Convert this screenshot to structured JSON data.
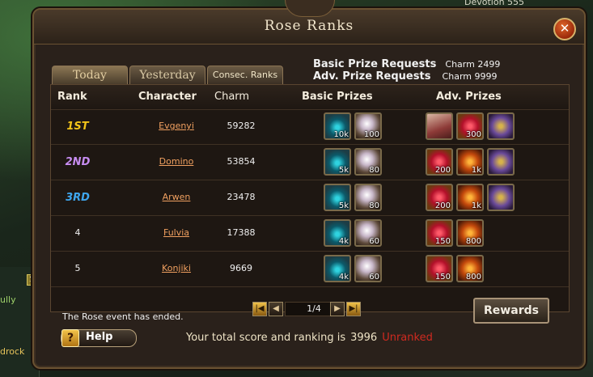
{
  "background": {
    "top_right_text": "Devotion 555",
    "left_text_1": "ully",
    "left_text_2": "drock"
  },
  "window": {
    "title": "Rose Ranks",
    "close_label": "✕"
  },
  "tabs": [
    {
      "label": "Today"
    },
    {
      "label": "Yesterday"
    },
    {
      "label": "Consec. Ranks"
    }
  ],
  "prize_requests": {
    "basic_label": "Basic Prize Requests",
    "basic_value": "Charm 2499",
    "adv_label": "Adv. Prize Requests",
    "adv_value": "Charm 9999"
  },
  "table": {
    "headers": {
      "rank": "Rank",
      "character": "Character",
      "charm": "Charm",
      "basic": "Basic Prizes",
      "adv": "Adv. Prizes"
    },
    "rows": [
      {
        "rank": "1ST",
        "rank_color": "#f2c419",
        "character": "Evgenyi",
        "charm": "59282",
        "basic": [
          {
            "icon": "shield-icon",
            "count": "10k"
          },
          {
            "icon": "pearl-icon",
            "count": "100"
          }
        ],
        "adv": [
          {
            "icon": "fairy-icon",
            "count": ""
          },
          {
            "icon": "gem-icon",
            "count": "300"
          },
          {
            "icon": "horn-icon",
            "count": ""
          }
        ]
      },
      {
        "rank": "2ND",
        "rank_color": "#c68cf0",
        "character": "Domino",
        "charm": "53854",
        "basic": [
          {
            "icon": "shield-icon",
            "count": "5k"
          },
          {
            "icon": "pearl-icon",
            "count": "80"
          }
        ],
        "adv": [
          {
            "icon": "gem-icon",
            "count": "200"
          },
          {
            "icon": "orb-icon",
            "count": "1k"
          },
          {
            "icon": "horn-icon",
            "count": ""
          }
        ]
      },
      {
        "rank": "3RD",
        "rank_color": "#3fa6ee",
        "character": "Arwen",
        "charm": "23478",
        "basic": [
          {
            "icon": "shield-icon",
            "count": "5k"
          },
          {
            "icon": "pearl-icon",
            "count": "80"
          }
        ],
        "adv": [
          {
            "icon": "gem-icon",
            "count": "200"
          },
          {
            "icon": "orb-icon",
            "count": "1k"
          },
          {
            "icon": "horn-icon",
            "count": ""
          }
        ]
      },
      {
        "rank": "4",
        "rank_color": "#f0f0f0",
        "character": "Fulvia",
        "charm": "17388",
        "basic": [
          {
            "icon": "shield-icon",
            "count": "4k"
          },
          {
            "icon": "pearl-icon",
            "count": "60"
          }
        ],
        "adv": [
          {
            "icon": "gem-icon",
            "count": "150"
          },
          {
            "icon": "orb-icon",
            "count": "800"
          }
        ]
      },
      {
        "rank": "5",
        "rank_color": "#f0f0f0",
        "character": "Konjiki",
        "charm": "9669",
        "basic": [
          {
            "icon": "shield-icon",
            "count": "4k"
          },
          {
            "icon": "pearl-icon",
            "count": "60"
          }
        ],
        "adv": [
          {
            "icon": "gem-icon",
            "count": "150"
          },
          {
            "icon": "orb-icon",
            "count": "800"
          }
        ]
      }
    ]
  },
  "footer": {
    "ended_text": "The Rose event has ended.",
    "page_display": "1/4",
    "rewards_label": "Rewards",
    "help_icon": "?",
    "help_label": "Help",
    "score_text": "Your total score and ranking is",
    "score_value": "3996",
    "ranking_status": "Unranked",
    "ranking_status_color": "#d02a20"
  }
}
